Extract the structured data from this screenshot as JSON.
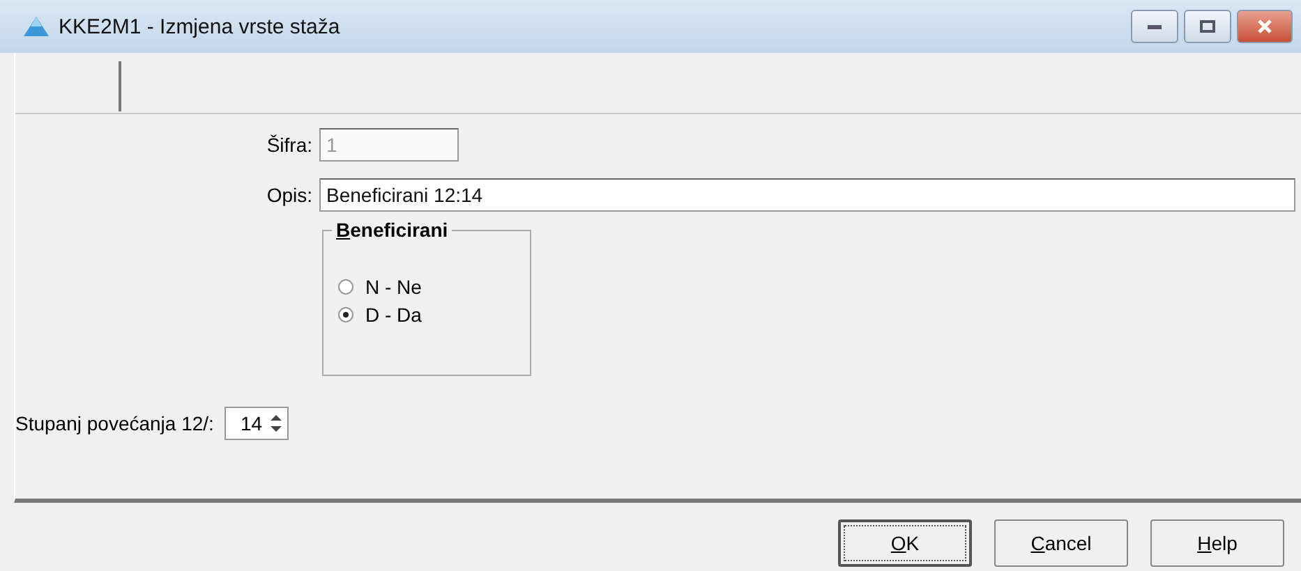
{
  "window": {
    "title": "KKE2M1 - Izmjena vrste staža"
  },
  "fields": [
    {
      "label": "Šifra:",
      "value": "1",
      "disabled": true
    },
    {
      "label": "Opis:",
      "value": "Beneficirani 12:14",
      "disabled": false
    }
  ],
  "group": {
    "title": "Beneficirani",
    "options": [
      {
        "label": "N - Ne",
        "selected": false
      },
      {
        "label": "D - Da",
        "selected": true
      }
    ]
  },
  "spinner": {
    "label": "Stupanj povećanja 12/:",
    "value": "14"
  },
  "buttons": [
    {
      "label": "OK",
      "default": true
    },
    {
      "label": "Cancel",
      "default": false
    },
    {
      "label": "Help",
      "default": false
    }
  ]
}
